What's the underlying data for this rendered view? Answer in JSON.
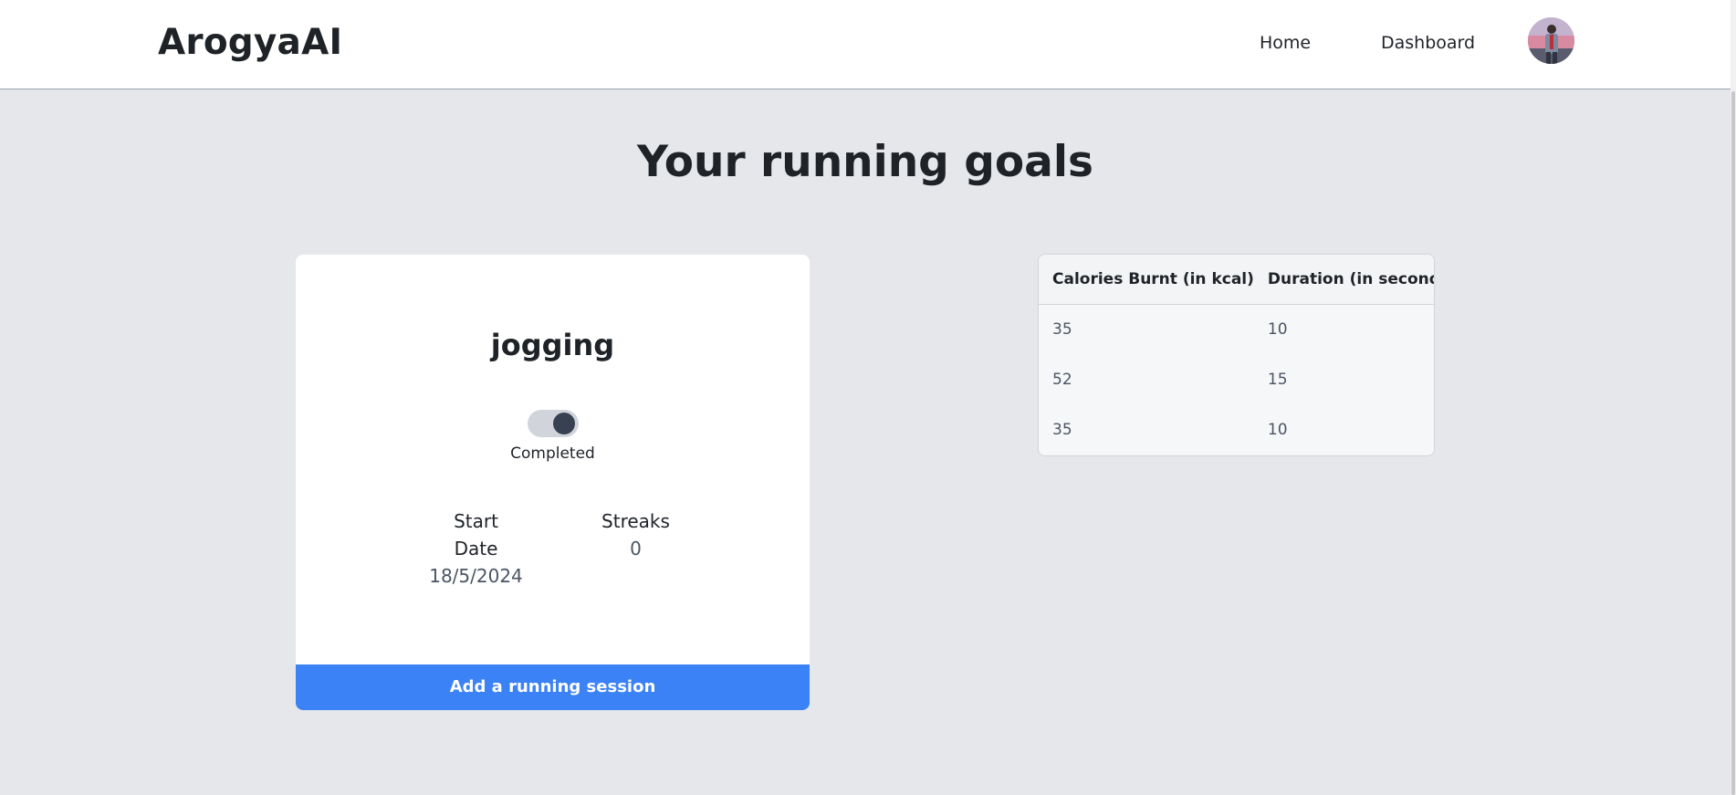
{
  "navbar": {
    "brand": "ArogyaAI",
    "links": [
      {
        "label": "Home"
      },
      {
        "label": "Dashboard"
      }
    ],
    "avatar_icon": "user-avatar"
  },
  "page": {
    "title": "Your running goals"
  },
  "goal_card": {
    "name": "jogging",
    "toggle": {
      "state": "on",
      "label": "Completed"
    },
    "start_date": {
      "label_line1": "Start",
      "label_line2": "Date",
      "value": "18/5/2024"
    },
    "streaks": {
      "label": "Streaks",
      "value": "0"
    },
    "add_button_label": "Add a running session",
    "accent_color": "#3b82f6"
  },
  "sessions_table": {
    "headers": [
      "Calories Burnt (in kcal)",
      "Duration (in seconds)"
    ],
    "rows": [
      [
        "35",
        "10"
      ],
      [
        "52",
        "15"
      ],
      [
        "35",
        "10"
      ]
    ]
  }
}
